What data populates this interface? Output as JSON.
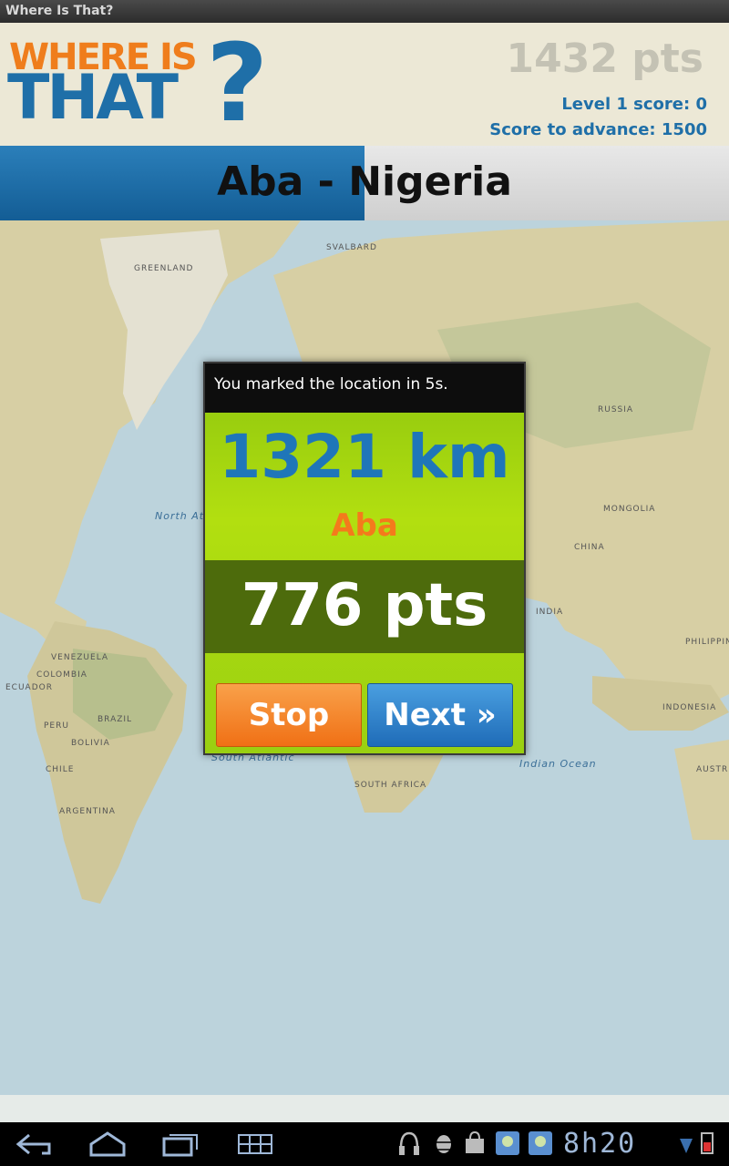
{
  "window": {
    "title": "Where Is That?"
  },
  "header": {
    "logo_line1": "WHERE IS",
    "logo_line2": "THAT",
    "logo_mark": "?",
    "total_points": "1432 pts",
    "level_score": "Level 1 score: 0",
    "advance_score": "Score to advance: 1500"
  },
  "location": {
    "name": "Aba - Nigeria",
    "timer_remaining_fraction": 0.5
  },
  "map": {
    "labels": {
      "greenland": "GREENLAND",
      "svalbard": "SVALBARD",
      "russia": "RUSSIA",
      "mongolia": "MONGOLIA",
      "china": "CHINA",
      "india": "INDIA",
      "brazil": "BRAZIL",
      "peru": "PERU",
      "argentina": "ARGENTINA",
      "chile": "CHILE",
      "bolivia": "BOLIVIA",
      "venezuela": "VENEZUELA",
      "colombia": "COLOMBIA",
      "ecuador": "ECUADOR",
      "south_africa": "SOUTH AFRICA",
      "indonesia": "INDONESIA",
      "australia": "AUSTR",
      "philippines": "PHILIPPINES",
      "north_atlantic": "North At",
      "south_atlantic": "South Atlantic",
      "indian_ocean": "Indian Ocean"
    },
    "colors": {
      "ocean": "#bcd3dc",
      "land": "#d7cfa4",
      "forest": "#b7bf8d"
    }
  },
  "result_dialog": {
    "message": "You marked the location in 5s.",
    "distance": "1321 km",
    "city": "Aba",
    "points": "776 pts",
    "stop_label": "Stop",
    "next_label": "Next »"
  },
  "navbar": {
    "icons": [
      "back-icon",
      "home-icon",
      "recent-apps-icon",
      "menu-grid-icon",
      "headphones-icon",
      "android-debug-icon",
      "shopping-bag-icon",
      "app-notification-icon",
      "app-notification-icon",
      "wifi-icon",
      "battery-icon"
    ],
    "clock": "8h20"
  }
}
